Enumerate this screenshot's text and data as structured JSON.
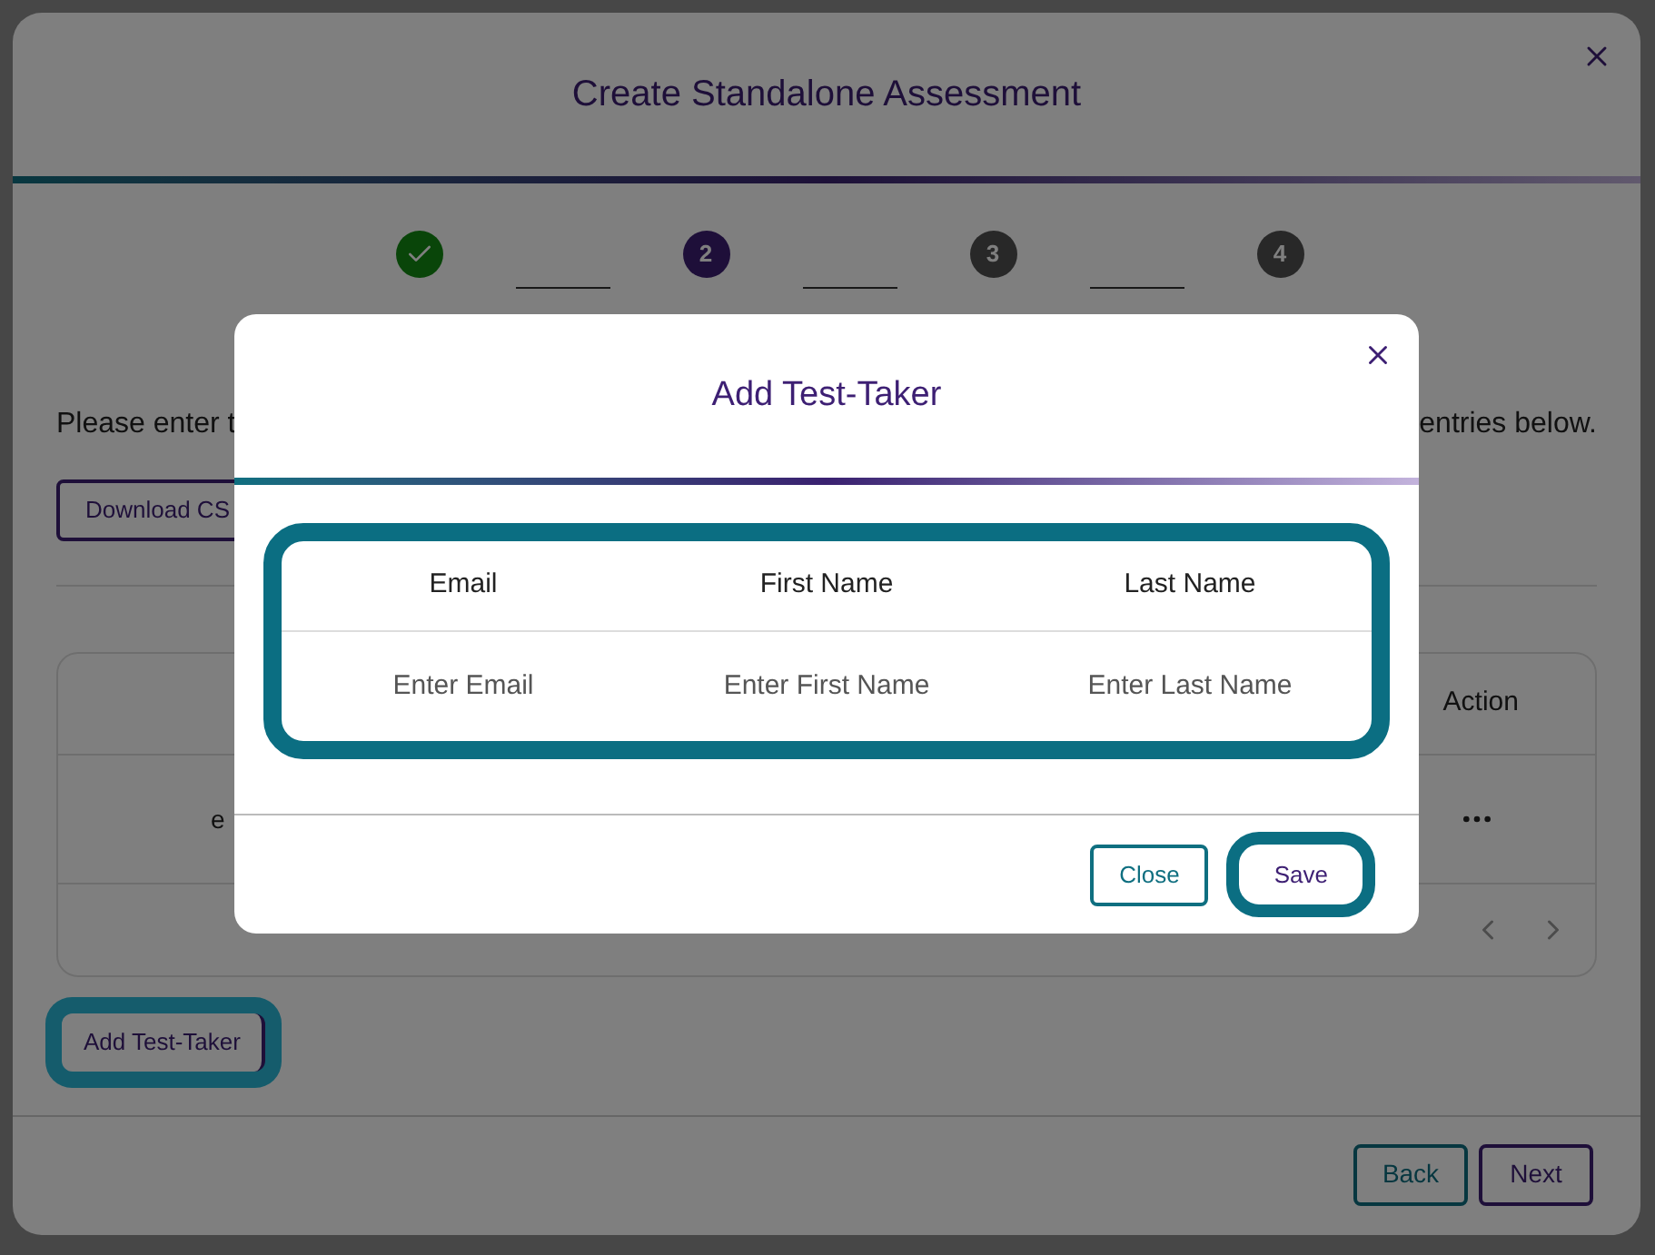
{
  "dialog": {
    "title": "Create Standalone Assessment",
    "steps": [
      {
        "done": true,
        "current": false
      },
      {
        "label": "2",
        "done": false,
        "current": true
      },
      {
        "label": "3",
        "done": false,
        "current": false
      },
      {
        "label": "4",
        "done": false,
        "current": false
      }
    ],
    "instruction_start": "Please enter t",
    "instruction_end": "entries below.",
    "download_button": "Download CS",
    "table": {
      "action_header": "Action",
      "row_cell": "e"
    },
    "add_button": {
      "label": "Add Test-Taker",
      "focused": true
    },
    "footer_buttons": [
      {
        "label": "Back",
        "kind": "secondary"
      },
      {
        "label": "Next",
        "kind": "primary"
      }
    ]
  },
  "modal": {
    "title": "Add Test-Taker",
    "columns": [
      {
        "header": "Email",
        "placeholder": "Enter Email"
      },
      {
        "header": "First Name",
        "placeholder": "Enter First Name"
      },
      {
        "header": "Last Name",
        "placeholder": "Enter Last Name"
      }
    ],
    "buttons": [
      {
        "label": "Close",
        "focused": false
      },
      {
        "label": "Save",
        "focused": true
      }
    ]
  }
}
